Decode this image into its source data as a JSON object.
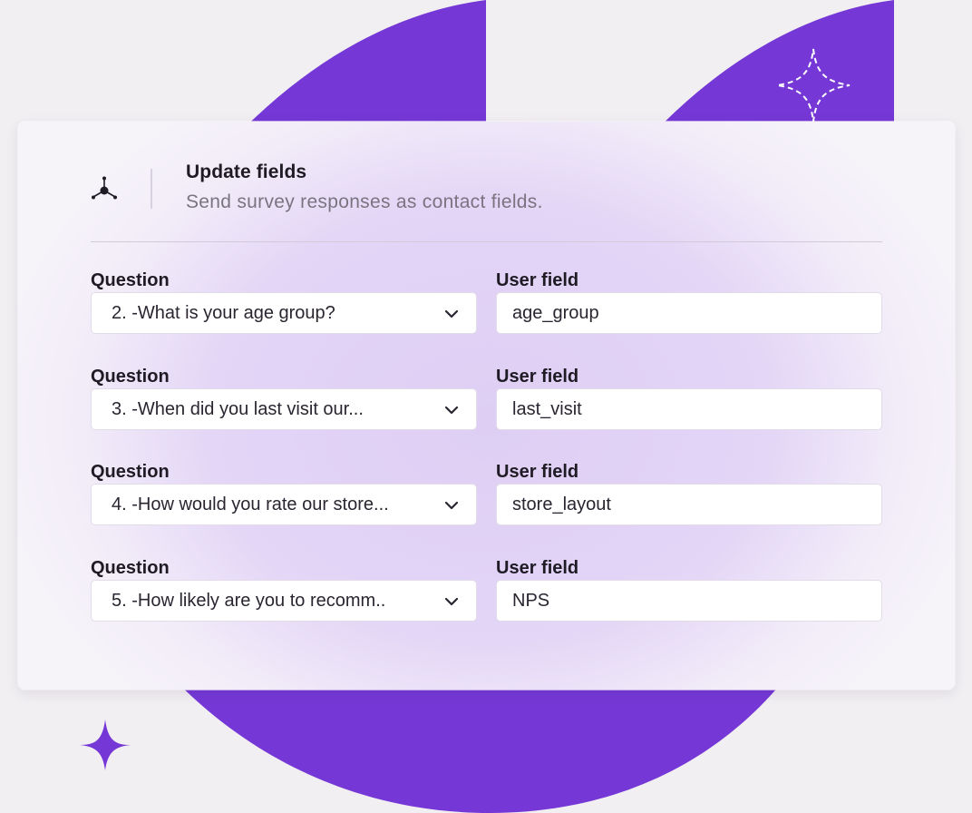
{
  "colors": {
    "background": "#f1eff2",
    "accent_purple": "#7538d6",
    "card_tint": "#e2d4f6"
  },
  "header": {
    "icon": "share-nodes-icon",
    "title": "Update fields",
    "subtitle": "Send survey responses as contact fields."
  },
  "mappings": [
    {
      "question_label": "Question",
      "question_value": "2. -What is your age group?",
      "field_label": "User field",
      "field_value": "age_group"
    },
    {
      "question_label": "Question",
      "question_value": "3. -When did you last visit our...",
      "field_label": "User field",
      "field_value": "last_visit"
    },
    {
      "question_label": "Question",
      "question_value": "4. -How would you rate our store...",
      "field_label": "User field",
      "field_value": "store_layout"
    },
    {
      "question_label": "Question",
      "question_value": "5. -How likely are you to recomm..",
      "field_label": "User field",
      "field_value": "NPS"
    }
  ],
  "decorations": [
    "sparkle-outline-icon",
    "sparkle-filled-icon"
  ]
}
